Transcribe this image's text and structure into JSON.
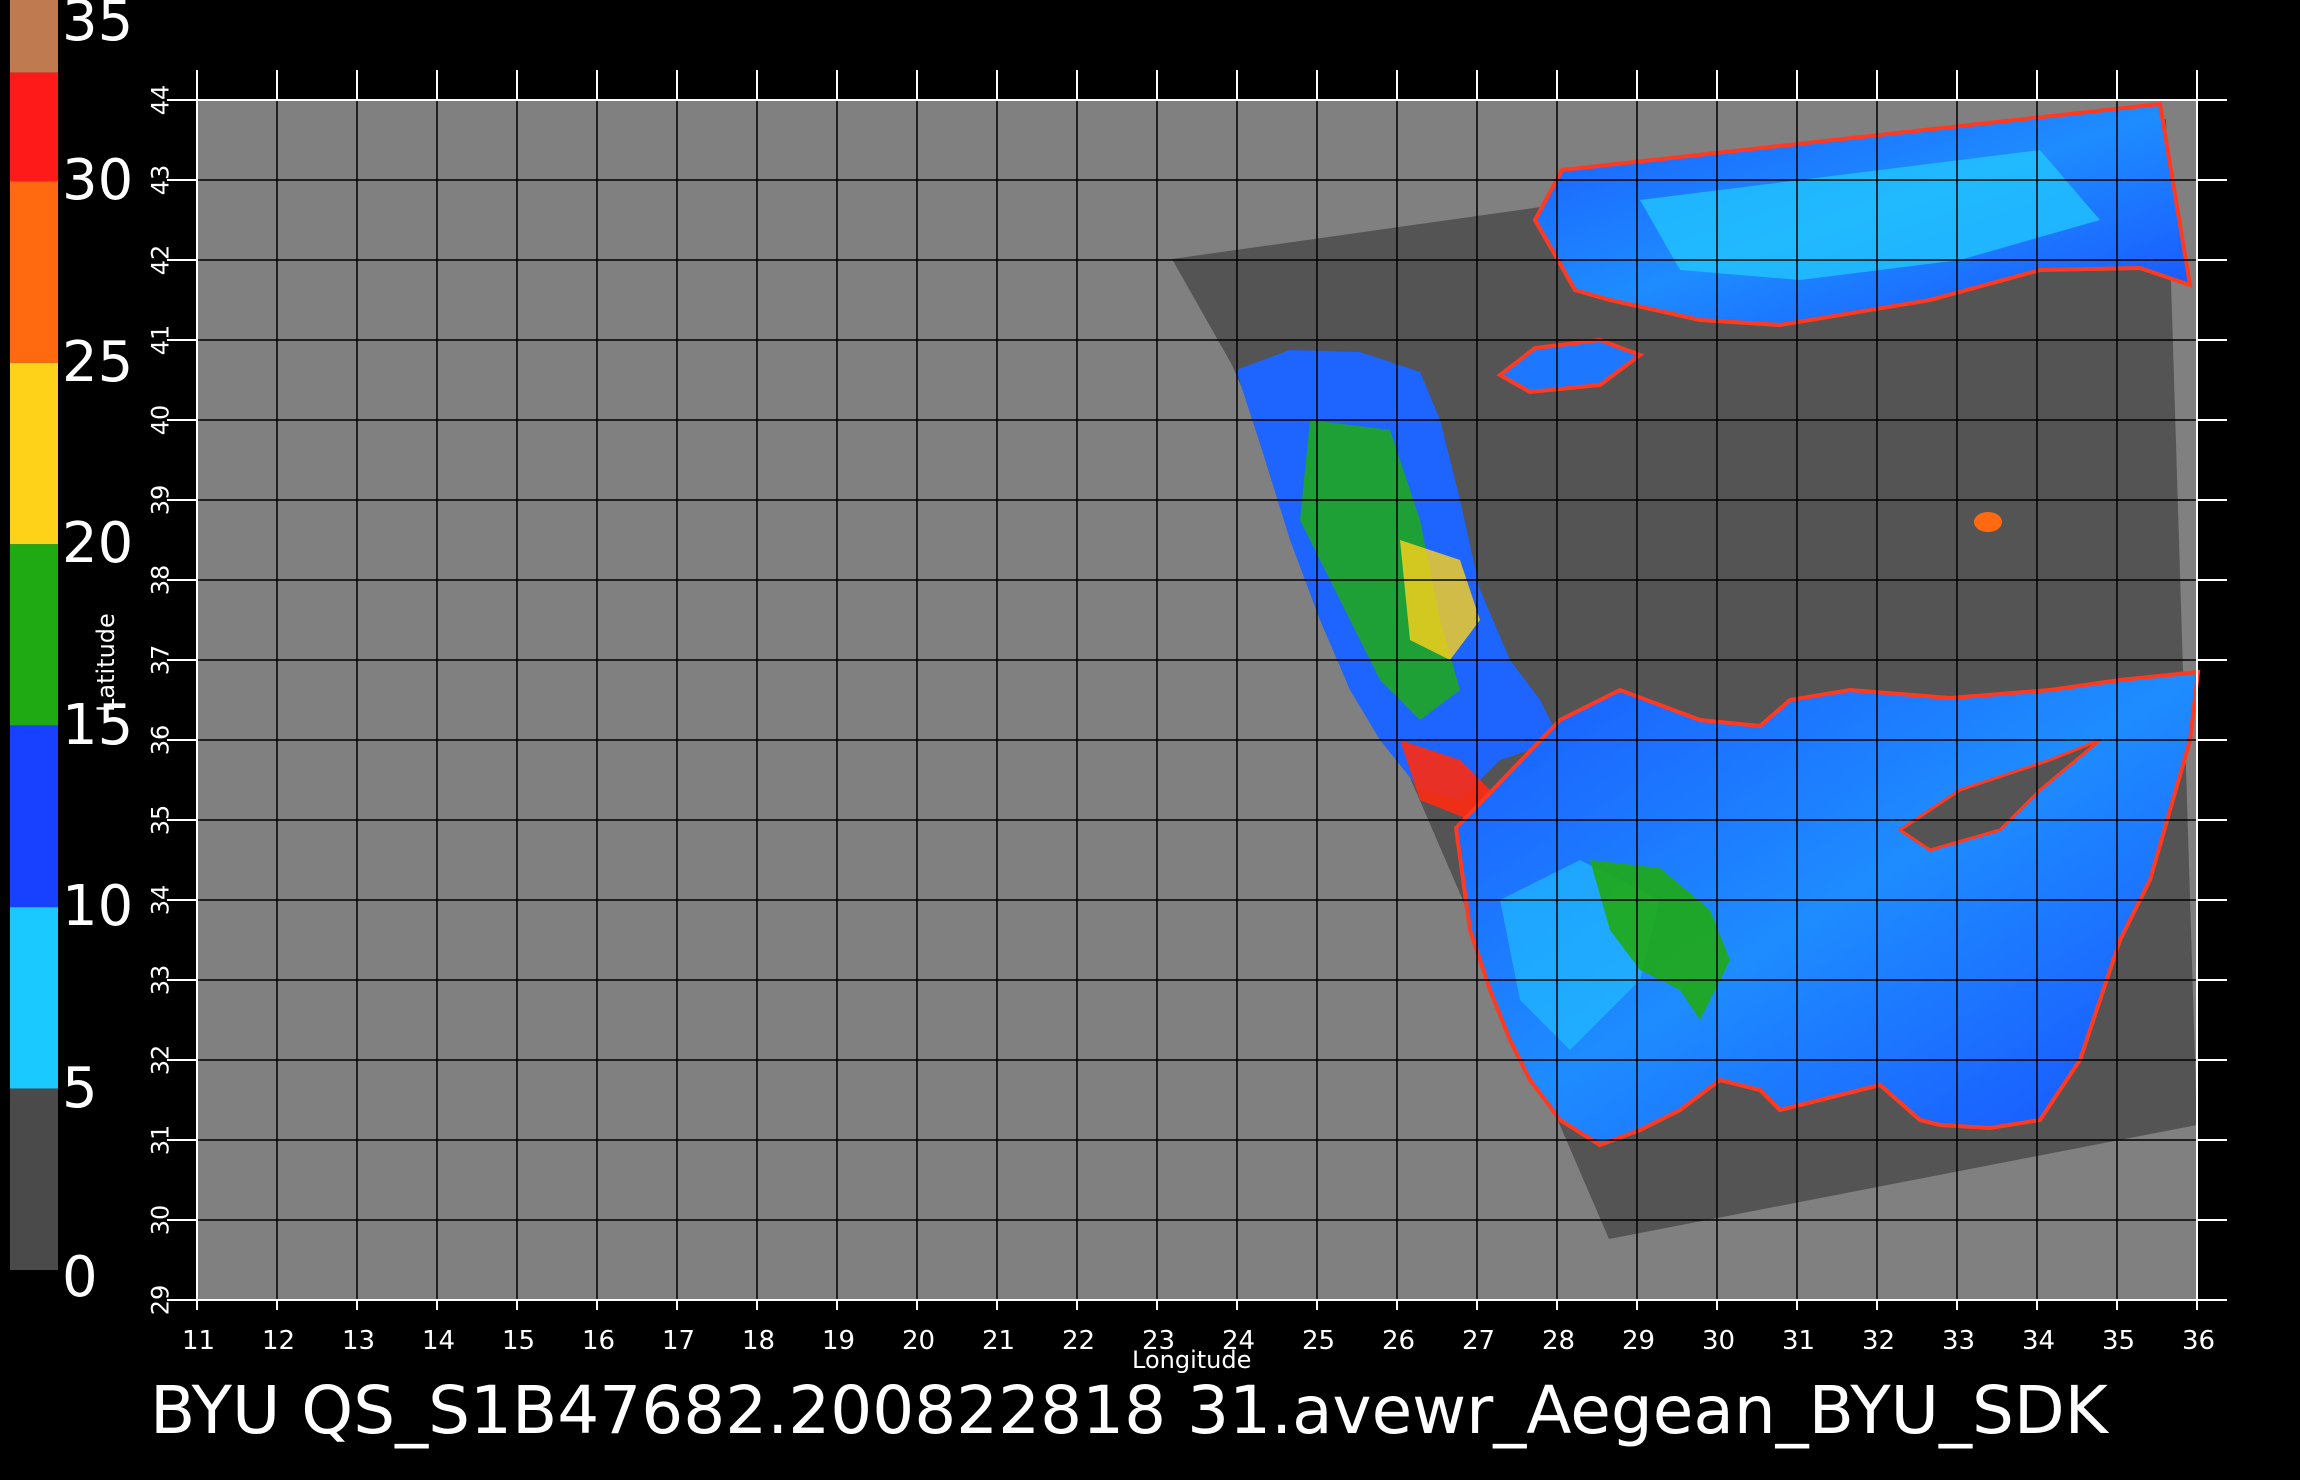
{
  "caption": "BYU  QS_S1B47682.200822818 31.avewr_Aegean_BYU_SDK",
  "colorbar": {
    "tick_labels": [
      "35",
      "30",
      "25",
      "20",
      "15",
      "10",
      "5",
      "0"
    ],
    "segments": [
      {
        "from": 35,
        "to": 33,
        "color": "#c07a50"
      },
      {
        "from": 33,
        "to": 30,
        "color": "#ff1a1a"
      },
      {
        "from": 30,
        "to": 25,
        "color": "#ff6a10"
      },
      {
        "from": 25,
        "to": 20,
        "color": "#ffd21a"
      },
      {
        "from": 20,
        "to": 15,
        "color": "#1faa14"
      },
      {
        "from": 15,
        "to": 10,
        "color": "#1840ff"
      },
      {
        "from": 10,
        "to": 5,
        "color": "#19c9ff"
      },
      {
        "from": 5,
        "to": 0,
        "color": "#4a4a4a"
      }
    ]
  },
  "map": {
    "xlabel": "Longitude",
    "ylabel": "Latitude",
    "lon_ticks": [
      "11",
      "12",
      "13",
      "14",
      "15",
      "16",
      "17",
      "18",
      "19",
      "20",
      "21",
      "22",
      "23",
      "24",
      "25",
      "26",
      "27",
      "28",
      "29",
      "30",
      "31",
      "32",
      "33",
      "34",
      "35",
      "36"
    ],
    "lat_ticks": [
      "29",
      "30",
      "31",
      "32",
      "33",
      "34",
      "35",
      "36",
      "37",
      "38",
      "39",
      "40",
      "41",
      "42",
      "43",
      "44"
    ],
    "lon_range": [
      11,
      36
    ],
    "lat_range": [
      29,
      44
    ],
    "background_color": "#808080",
    "swath_color": "#545454",
    "grid": true
  }
}
